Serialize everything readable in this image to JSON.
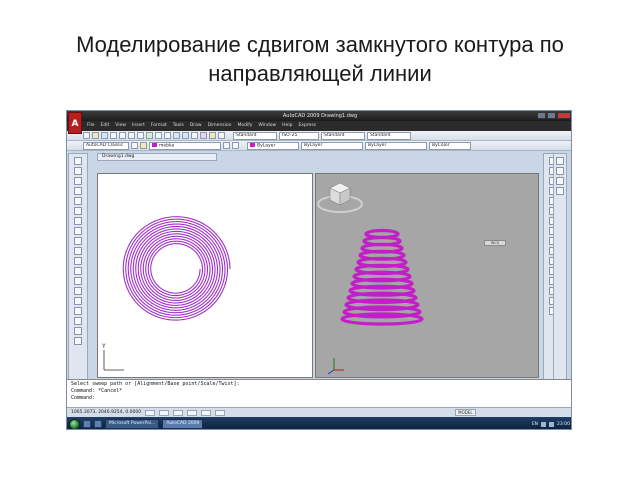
{
  "slide": {
    "title": "Моделирование сдвигом замкнутого контура по направляющей линии"
  },
  "app": {
    "logo": "A",
    "window_title": "AutoCAD 2009 Drawing1.dwg",
    "document_tab": "Drawing1.dwg"
  },
  "menu": {
    "items": [
      "File",
      "Edit",
      "View",
      "Insert",
      "Format",
      "Tools",
      "Draw",
      "Dimension",
      "Modify",
      "Window",
      "Help",
      "Express"
    ]
  },
  "toolbar": {
    "text_style": "Standard",
    "dim_style": "ISO-25",
    "table_style": "Standard",
    "multileader_style": "Standard",
    "workspace": "AutoCAD Classic",
    "layer": "mebka",
    "color": "ByLayer",
    "linetype": "ByLayer",
    "lineweight": "ByLayer",
    "plot_style": "ByColor"
  },
  "viewport": {
    "wcs_label": "WCS",
    "y_axis_label": "Y"
  },
  "command": {
    "lines": [
      "Select sweep path or [Alignment/Base point/Scale/Twist]:",
      "Command: *Cancel*",
      "",
      "Command:"
    ]
  },
  "status": {
    "coordinates": "1065.3073, 2046.9254, 0.0000",
    "model": "MODEL"
  },
  "taskbar": {
    "apps": [
      "Microsoft PowerPoi...",
      "AutoCAD 2009"
    ],
    "language": "EN",
    "clock": "23:00"
  },
  "colors": {
    "spiral": "#a030c8",
    "spring": "#c21fc8",
    "viewport_3d_bg": "#a6a6a6"
  }
}
